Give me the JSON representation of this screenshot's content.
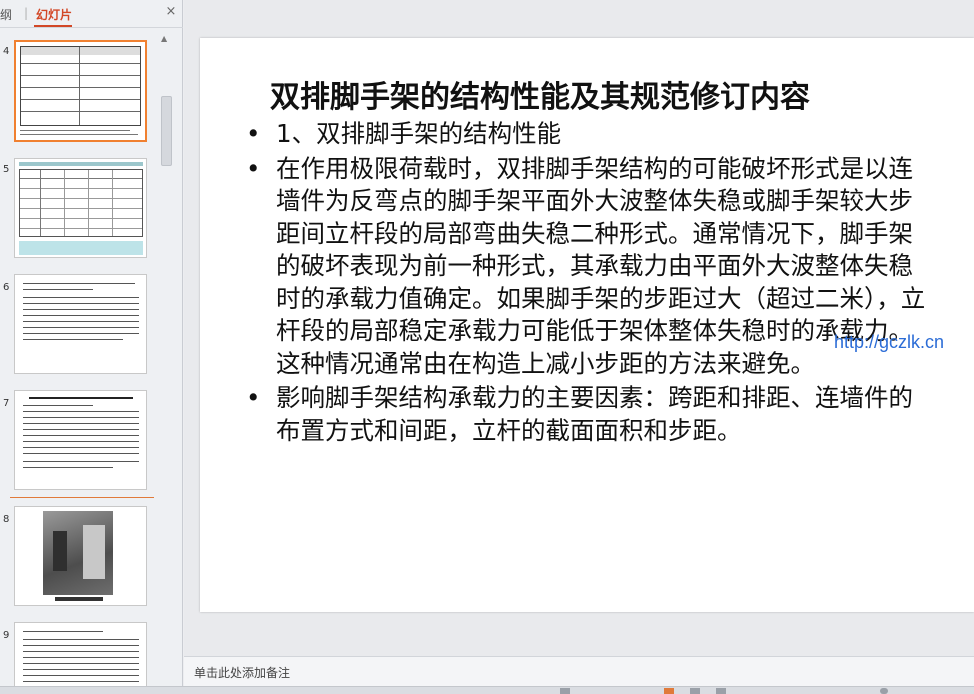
{
  "panel": {
    "tab_outline": "纲",
    "tab_separator": "|",
    "tab_slides": "幻灯片",
    "close_icon": "×"
  },
  "slides": [
    {
      "number": "4",
      "selected": true
    },
    {
      "number": "5",
      "selected": false
    },
    {
      "number": "6",
      "selected": false
    },
    {
      "number": "7",
      "selected": false
    },
    {
      "number": "8",
      "selected": false
    },
    {
      "number": "9",
      "selected": false
    }
  ],
  "slide": {
    "title": "双排脚手架的结构性能及其规范修订内容",
    "bullets": [
      "1、双排脚手架的结构性能",
      "在作用极限荷载时，双排脚手架结构的可能破坏形式是以连墙件为反弯点的脚手架平面外大波整体失稳或脚手架较大步距间立杆段的局部弯曲失稳二种形式。通常情况下，脚手架的破坏表现为前一种形式，其承载力由平面外大波整体失稳时的承载力值确定。如果脚手架的步距过大（超过二米），立杆段的局部稳定承载力可能低于架体整体失稳时的承载力。这种情况通常由在构造上减小步距的方法来避免。",
      "影响脚手架结构承载力的主要因素：跨距和排距、连墙件的布置方式和间距，立杆的截面面积和步距。"
    ],
    "watermark": "http://gczlk.cn"
  },
  "notes": {
    "placeholder": "单击此处添加备注"
  }
}
